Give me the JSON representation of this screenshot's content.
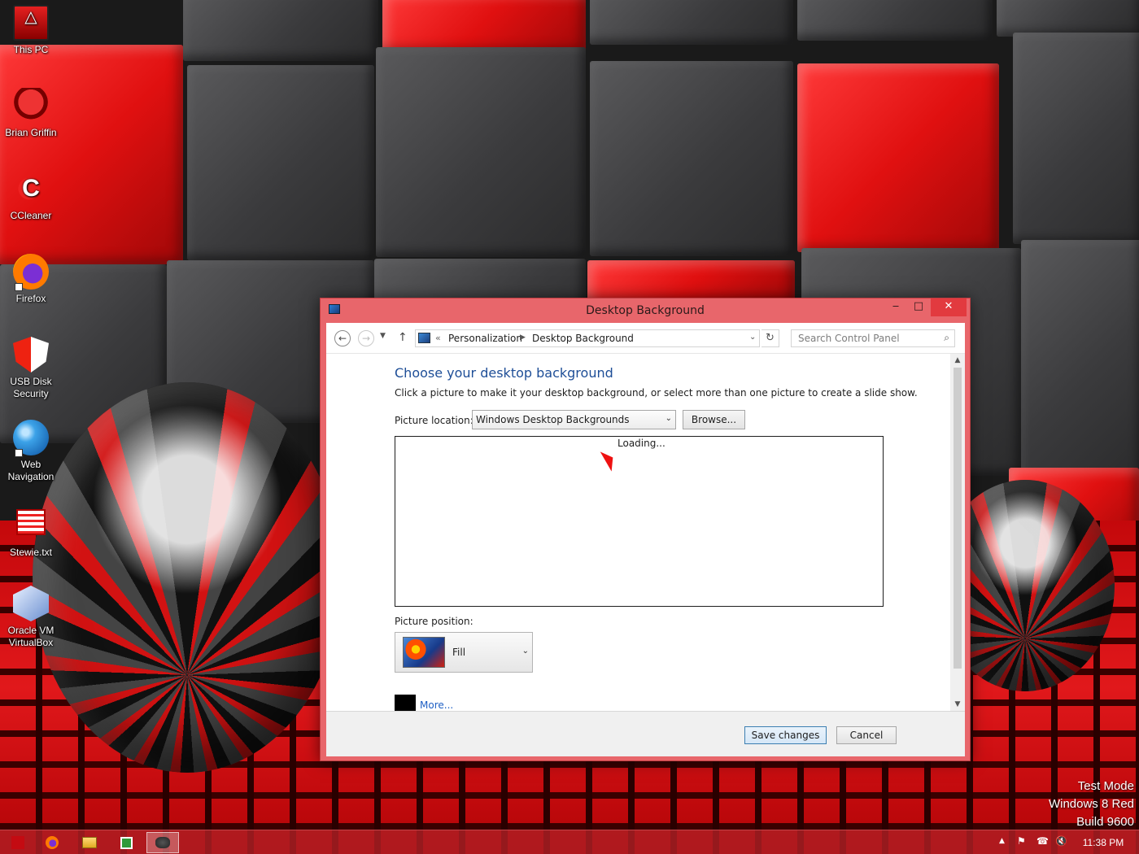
{
  "desktop": {
    "icons": [
      {
        "label": "This PC",
        "icon": "this-pc-icon"
      },
      {
        "label": "Brian Griffin",
        "icon": "brian-griffin-icon"
      },
      {
        "label": "CCleaner",
        "icon": "ccleaner-icon"
      },
      {
        "label": "Firefox",
        "icon": "firefox-icon"
      },
      {
        "label": "USB Disk Security",
        "icon": "usb-disk-security-icon"
      },
      {
        "label": "Web Navigation",
        "icon": "web-navigation-icon"
      },
      {
        "label": "Stewie.txt",
        "icon": "text-file-icon"
      },
      {
        "label": "Oracle VM VirtualBox",
        "icon": "virtualbox-icon"
      }
    ],
    "watermark": {
      "line1": "Test Mode",
      "line2": "Windows 8 Red",
      "line3": "Build 9600"
    }
  },
  "window": {
    "title": "Desktop Background",
    "controls": {
      "minimize": "‒",
      "maximize": "□",
      "close": "✕"
    },
    "navigation": {
      "back_glyph": "←",
      "forward_glyph": "→",
      "recent_glyph": "▼",
      "up_glyph": "↑",
      "chevron": "«",
      "breadcrumbs": [
        "Personalization",
        "Desktop Background"
      ],
      "breadcrumb_separator": "▶",
      "dropdown_glyph": "⌄",
      "refresh_glyph": "↻",
      "search_placeholder": "Search Control Panel",
      "search_glyph": "⌕"
    },
    "content": {
      "heading": "Choose your desktop background",
      "instructions": "Click a picture to make it your desktop background, or select more than one picture to create a slide show.",
      "picture_location_label": "Picture location:",
      "picture_location_value": "Windows Desktop Backgrounds",
      "browse_label": "Browse...",
      "gallery_status": "Loading...",
      "picture_position_label": "Picture position:",
      "picture_position_value": "Fill",
      "more_link": "More...",
      "background_color": "#000000"
    },
    "scrollbar": {
      "up_glyph": "▲",
      "down_glyph": "▼"
    },
    "footer": {
      "save_label": "Save changes",
      "cancel_label": "Cancel"
    },
    "frame_color": "#e8666b",
    "heading_color": "#1e4e97",
    "link_color": "#1e5fc4"
  },
  "taskbar": {
    "items": [
      {
        "name": "start",
        "icon": "windows-start-icon"
      },
      {
        "name": "firefox",
        "icon": "firefox-icon"
      },
      {
        "name": "file-explorer",
        "icon": "folder-icon"
      },
      {
        "name": "store",
        "icon": "store-icon"
      },
      {
        "name": "control-panel",
        "icon": "control-panel-icon"
      }
    ],
    "tray": {
      "show_hidden": "▲",
      "flag": "⚑",
      "network": "☎",
      "volume": "🔇"
    },
    "clock": "11:38 PM",
    "color": "#af1e23"
  }
}
